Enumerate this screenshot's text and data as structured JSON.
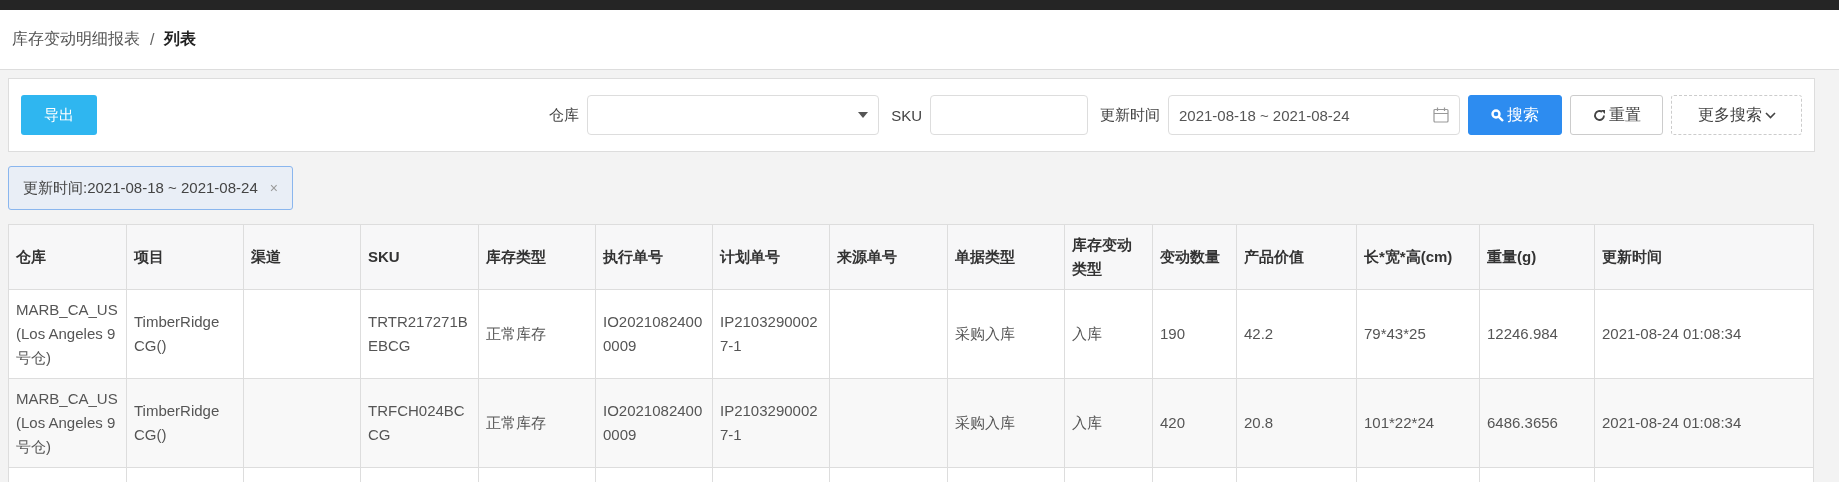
{
  "breadcrumb": [
    {
      "label": "库存变动明细报表",
      "current": false
    },
    {
      "label": "列表",
      "current": true
    }
  ],
  "separator": "/",
  "toolbar": {
    "export_button": "导出",
    "filters": [
      {
        "kind": "select",
        "label": "仓库"
      },
      {
        "kind": "text",
        "label": "SKU"
      },
      {
        "kind": "date-range",
        "label": "更新时间",
        "value": "2021-08-18 ~ 2021-08-24"
      }
    ],
    "buttons": [
      {
        "kind": "primary",
        "label": "搜索"
      },
      {
        "kind": "default",
        "label": "重置"
      },
      {
        "kind": "dashed",
        "label": "更多搜索"
      }
    ]
  },
  "active_filters": [
    {
      "label": "更新时间:2021-08-18 ~ 2021-08-24",
      "close": "×"
    }
  ],
  "table": {
    "columns": [
      "仓库",
      "项目",
      "渠道",
      "SKU",
      "库存类型",
      "执行单号",
      "计划单号",
      "来源单号",
      "单据类型",
      "库存变动类型",
      "变动数量",
      "产品价值",
      "长*宽*高(cm)",
      "重量(g)",
      "更新时间"
    ],
    "rows": [
      {
        "cells": [
          "MARB_CA_US (Los Angeles 9号仓)",
          "TimberRidge CG()",
          "",
          "TRTR217271BEBCG",
          "正常库存",
          "IO20210824000009",
          "IP21032900027-1",
          "",
          "采购入库",
          "入库",
          "190",
          "42.2",
          "79*43*25",
          "12246.984",
          "2021-08-24 01:08:34"
        ]
      },
      {
        "cells": [
          "MARB_CA_US (Los Angeles 9号仓)",
          "TimberRidge CG()",
          "",
          "TRFCH024BCCG",
          "正常库存",
          "IO20210824000009",
          "IP21032900027-1",
          "",
          "采购入库",
          "入库",
          "420",
          "20.8",
          "101*22*24",
          "6486.3656",
          "2021-08-24 01:08:34"
        ]
      }
    ]
  }
}
